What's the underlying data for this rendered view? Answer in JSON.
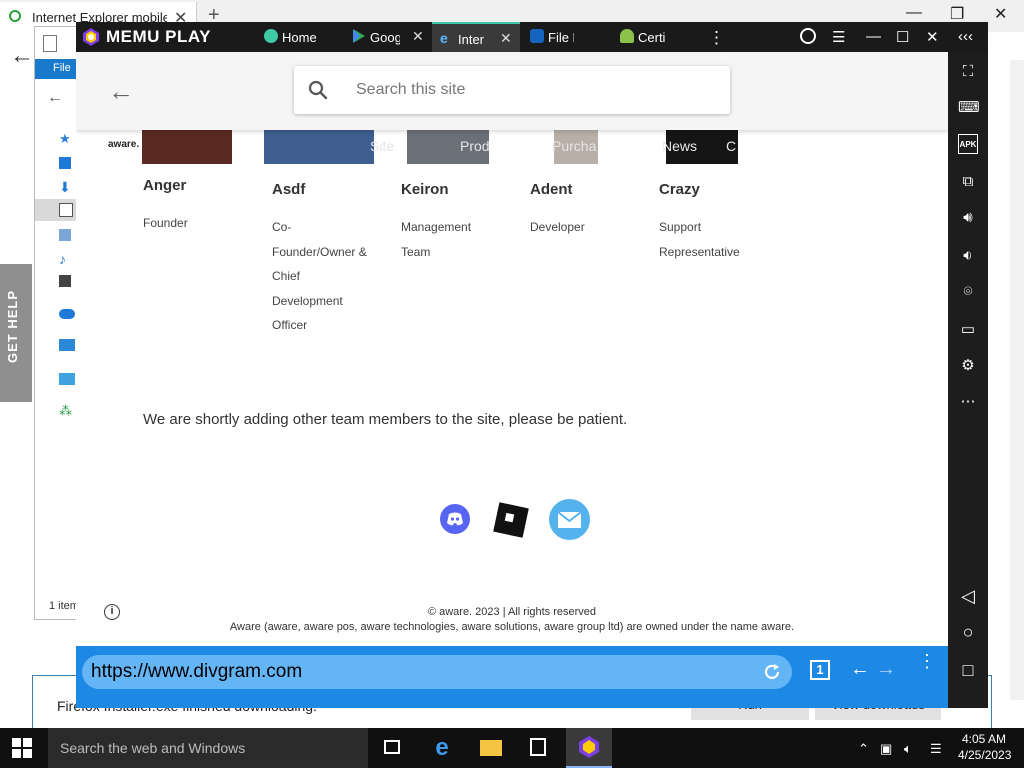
{
  "firefox": {
    "tab_title": "Internet Explorer mobile",
    "new_tab": "+",
    "close_tab": "✕",
    "minimize": "—",
    "maximize": "❐",
    "close": "✕",
    "back": "←"
  },
  "explorer": {
    "file_menu": "File",
    "status": "1 item"
  },
  "get_help": {
    "label": "GET HELP"
  },
  "download_bar": {
    "text": "Firefox Installer.exe finished downloading.",
    "run_label": "Run",
    "view_label": "View downloads",
    "close": "✕"
  },
  "memu": {
    "brand": "MEMU PLAY",
    "tabs": [
      {
        "label": "Home",
        "color": "#3ec9a7"
      },
      {
        "label": "Goog",
        "color": "#34a853"
      },
      {
        "label": "Inter",
        "color": "#1e88e5"
      },
      {
        "label": "File M",
        "color": "#1565c0"
      },
      {
        "label": "Certi",
        "color": "#8bc34a"
      }
    ],
    "tab_close": "✕",
    "more": "⋮",
    "controls": {
      "menu": "☰",
      "minimize": "—",
      "maximize": "☐",
      "close": "✕",
      "collapse": "‹‹‹"
    },
    "sidebar_icons": [
      "fullscreen-icon",
      "keyboard-icon",
      "apk-icon",
      "multi-window-icon",
      "volume-up-icon",
      "volume-down-icon",
      "location-icon",
      "folder-icon",
      "settings-icon",
      "more-icon",
      "android-back-icon",
      "android-home-icon",
      "android-recents-icon"
    ],
    "apk_label": "APK",
    "android": {
      "back": "◁",
      "home": "○",
      "recents": "□"
    }
  },
  "site": {
    "back": "←",
    "search_placeholder": "Search this site",
    "aware_mini": "aware.",
    "nav_ghost": [
      "Site",
      "Prod",
      "Purcha",
      "News",
      "C"
    ],
    "team": [
      {
        "name": "Anger",
        "role": "Founder"
      },
      {
        "name": "Asdf",
        "role": "Co-Founder/Owner & Chief Development Officer"
      },
      {
        "name": "Keiron",
        "role": "Management Team"
      },
      {
        "name": "Adent",
        "role": "Developer"
      },
      {
        "name": "Crazy",
        "role": "Support Representative"
      }
    ],
    "notice": "We are shortly adding other team members to the site, please be patient.",
    "info": "i",
    "copyright": "© aware. 2023 | All rights reserved",
    "ownership": "Aware (aware, aware pos, aware technologies, aware solutions, aware group ltd) are owned under the name aware."
  },
  "browser": {
    "url": "https://www.divgram.com",
    "tab_count": "1",
    "back": "←",
    "forward": "→",
    "menu": "⋮"
  },
  "taskbar": {
    "search_placeholder": "Search the web and Windows",
    "time": "4:05 AM",
    "date": "4/25/2023"
  }
}
